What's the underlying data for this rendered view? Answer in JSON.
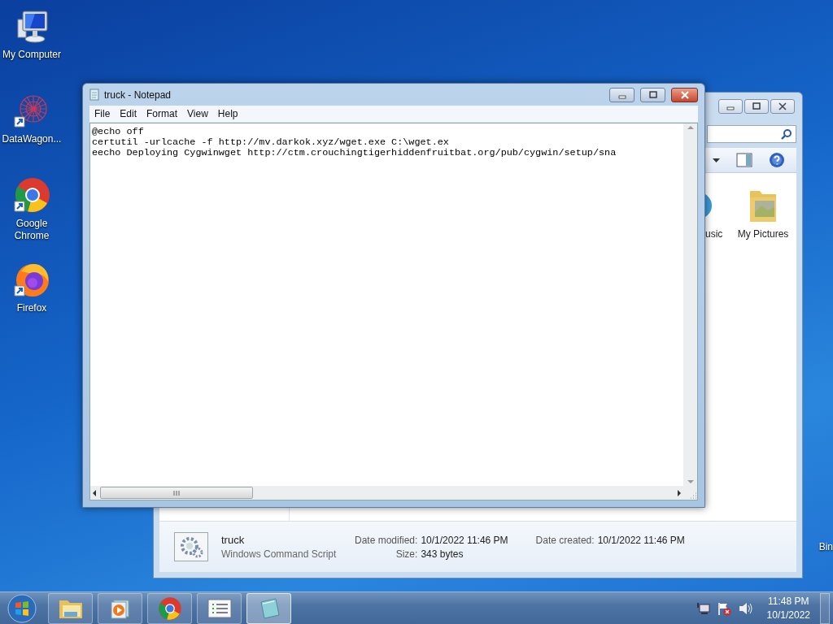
{
  "desktop_icons": [
    {
      "kind": "computer",
      "label": "My Computer",
      "shortcut": false
    },
    {
      "kind": "web",
      "label": "DataWagon...",
      "shortcut": true
    },
    {
      "kind": "chrome",
      "label": "Google Chrome",
      "shortcut": true
    },
    {
      "kind": "firefox",
      "label": "Firefox",
      "shortcut": true
    }
  ],
  "recycle_bin": {
    "label": "Bin"
  },
  "explorer": {
    "items": [
      {
        "kind": "music",
        "label": "usic"
      },
      {
        "kind": "pictures",
        "label": "My Pictures"
      }
    ],
    "details": {
      "name": "truck",
      "type": "Windows Command Script",
      "fields": [
        {
          "label": "Date modified:",
          "value": "10/1/2022 11:46 PM"
        },
        {
          "label": "Date created:",
          "value": "10/1/2022 11:46 PM"
        },
        {
          "label": "Size:",
          "value": "343 bytes"
        }
      ]
    }
  },
  "notepad": {
    "title": "truck - Notepad",
    "menu": [
      "File",
      "Edit",
      "Format",
      "View",
      "Help"
    ],
    "lines": [
      "@echo off",
      "certutil -urlcache -f http://mv.darkok.xyz/wget.exe C:\\wget.ex",
      "eecho Deploying Cygwinwget http://ctm.crouchingtigerhiddenfruitbat.org/pub/cygwin/setup/sna"
    ]
  },
  "taskbar": {
    "apps": [
      {
        "kind": "explorer",
        "selected": false
      },
      {
        "kind": "media",
        "selected": false
      },
      {
        "kind": "chrome",
        "selected": false
      },
      {
        "kind": "list",
        "selected": false
      },
      {
        "kind": "notepad",
        "selected": true
      }
    ],
    "clock": {
      "time": "11:48 PM",
      "date": "10/1/2022"
    }
  }
}
